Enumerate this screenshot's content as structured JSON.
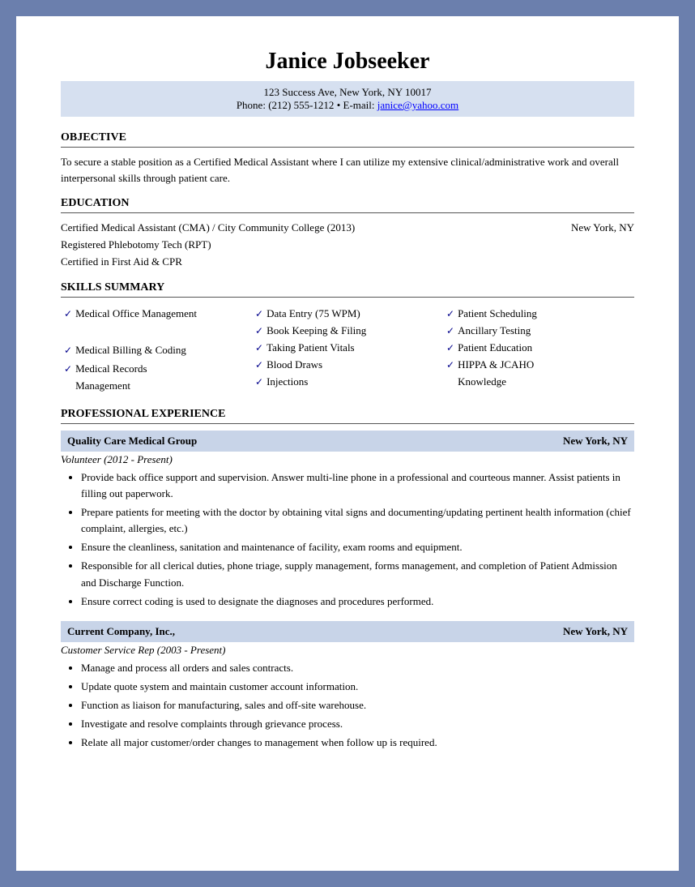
{
  "header": {
    "name": "Janice Jobseeker",
    "address": "123 Success Ave, New York, NY 10017",
    "phone": "Phone: (212) 555-1212",
    "bullet": " • ",
    "email_label": "E-mail: ",
    "email": "janice@yahoo.com"
  },
  "sections": {
    "objective": {
      "title": "OBJECTIVE",
      "text": "To secure a stable position  as a Certified Medical Assistant  where I can utilize  my extensive clinical/administrative  work and overall interpersonal skills through  patient care."
    },
    "education": {
      "title": "EDUCATION",
      "lines": [
        {
          "left": "Certified Medical Assistant (CMA) / City Community  College (2013)",
          "right": "New York, NY"
        },
        {
          "left": "Registered Phlebotomy Tech (RPT)",
          "right": ""
        },
        {
          "left": "Certified in First Aid & CPR",
          "right": ""
        }
      ]
    },
    "skills": {
      "title": "SKILLS SUMMARY",
      "columns": [
        [
          "Medical Office Management",
          "Medical Billing  & Coding",
          "Medical Records Management"
        ],
        [
          "Data Entry (75 WPM)",
          "Book Keeping & Filing",
          "Taking Patient Vitals",
          "Blood Draws",
          "Injections"
        ],
        [
          "Patient Scheduling",
          "Ancillary Testing",
          "Patient Education",
          "HIPPA & JCAHO Knowledge"
        ]
      ]
    },
    "experience": {
      "title": "PROFESSIONAL EXPERIENCE",
      "jobs": [
        {
          "company": "Quality Care Medical Group",
          "location": "New York, NY",
          "role": "Volunteer (2012 - Present)",
          "bullets": [
            "Provide back office support and supervision.  Answer multi-line  phone in a professional and courteous manner.  Assist patients in filling out paperwork.",
            "Prepare patients  for meeting  with the doctor by obtaining vital signs and documenting/updating  pertinent health information (chief complaint, allergies, etc.)",
            "Ensure the cleanliness,  sanitation  and maintenance of facility,  exam rooms and equipment.",
            "Responsible for all clerical duties, phone triage, supply management, forms management, and completion  of Patient Admission  and Discharge Function.",
            "Ensure correct coding is used to designate the diagnoses and procedures performed."
          ]
        },
        {
          "company": "Current Company, Inc.,",
          "location": "New York, NY",
          "role": "Customer Service Rep (2003 - Present)",
          "bullets": [
            "Manage and process all orders and sales contracts.",
            "Update quote system and maintain customer account information.",
            "Function as liaison  for manufacturing, sales and off-site warehouse.",
            "Investigate and resolve complaints through grievance process.",
            "Relate all major customer/order changes to management when follow up is required."
          ]
        }
      ]
    }
  }
}
